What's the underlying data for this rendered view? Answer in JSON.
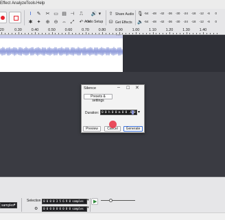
{
  "menu": [
    "Effect",
    "Analyze",
    "Tools",
    "Help"
  ],
  "toolbar": {
    "audio_setup_label": "Audio Setup",
    "share_audio_label": "Share Audio",
    "get_effects_label": "Get Effects",
    "meter_ticks": [
      "-54",
      "-48",
      "-42",
      "-36",
      "-30",
      "-24",
      "-18",
      "-12",
      "-6",
      "0"
    ]
  },
  "ruler": {
    "ticks": [
      ".20",
      "0.30",
      "0.40",
      "0.50",
      "0.60",
      "0.70",
      "0.80",
      "0.90",
      "1.00",
      "1.10",
      "1.20",
      "1.30",
      "1.40"
    ]
  },
  "dialog": {
    "title": "Silence",
    "presets_label": "Presets & settings",
    "duration_label": "Duration:",
    "duration_value": "0 0 h 0 0 m 0 0 .0 0 0",
    "preview_label": "Preview",
    "cancel_label": "Cancel",
    "generate_label": "Generate"
  },
  "bottom": {
    "samples_label": "samples",
    "selection_label": "Selection",
    "selection_start": "0 0 0 0 3 5 6 9 0 samples",
    "selection_end": "0 0 0 0 0 0 0 0 0 samples"
  },
  "colors": {
    "accent": "#8a93d8",
    "record": "#e8222e",
    "waveform": "#6f7fcf",
    "background": "#2b2c33",
    "cursor_dot": "#e8394a"
  }
}
